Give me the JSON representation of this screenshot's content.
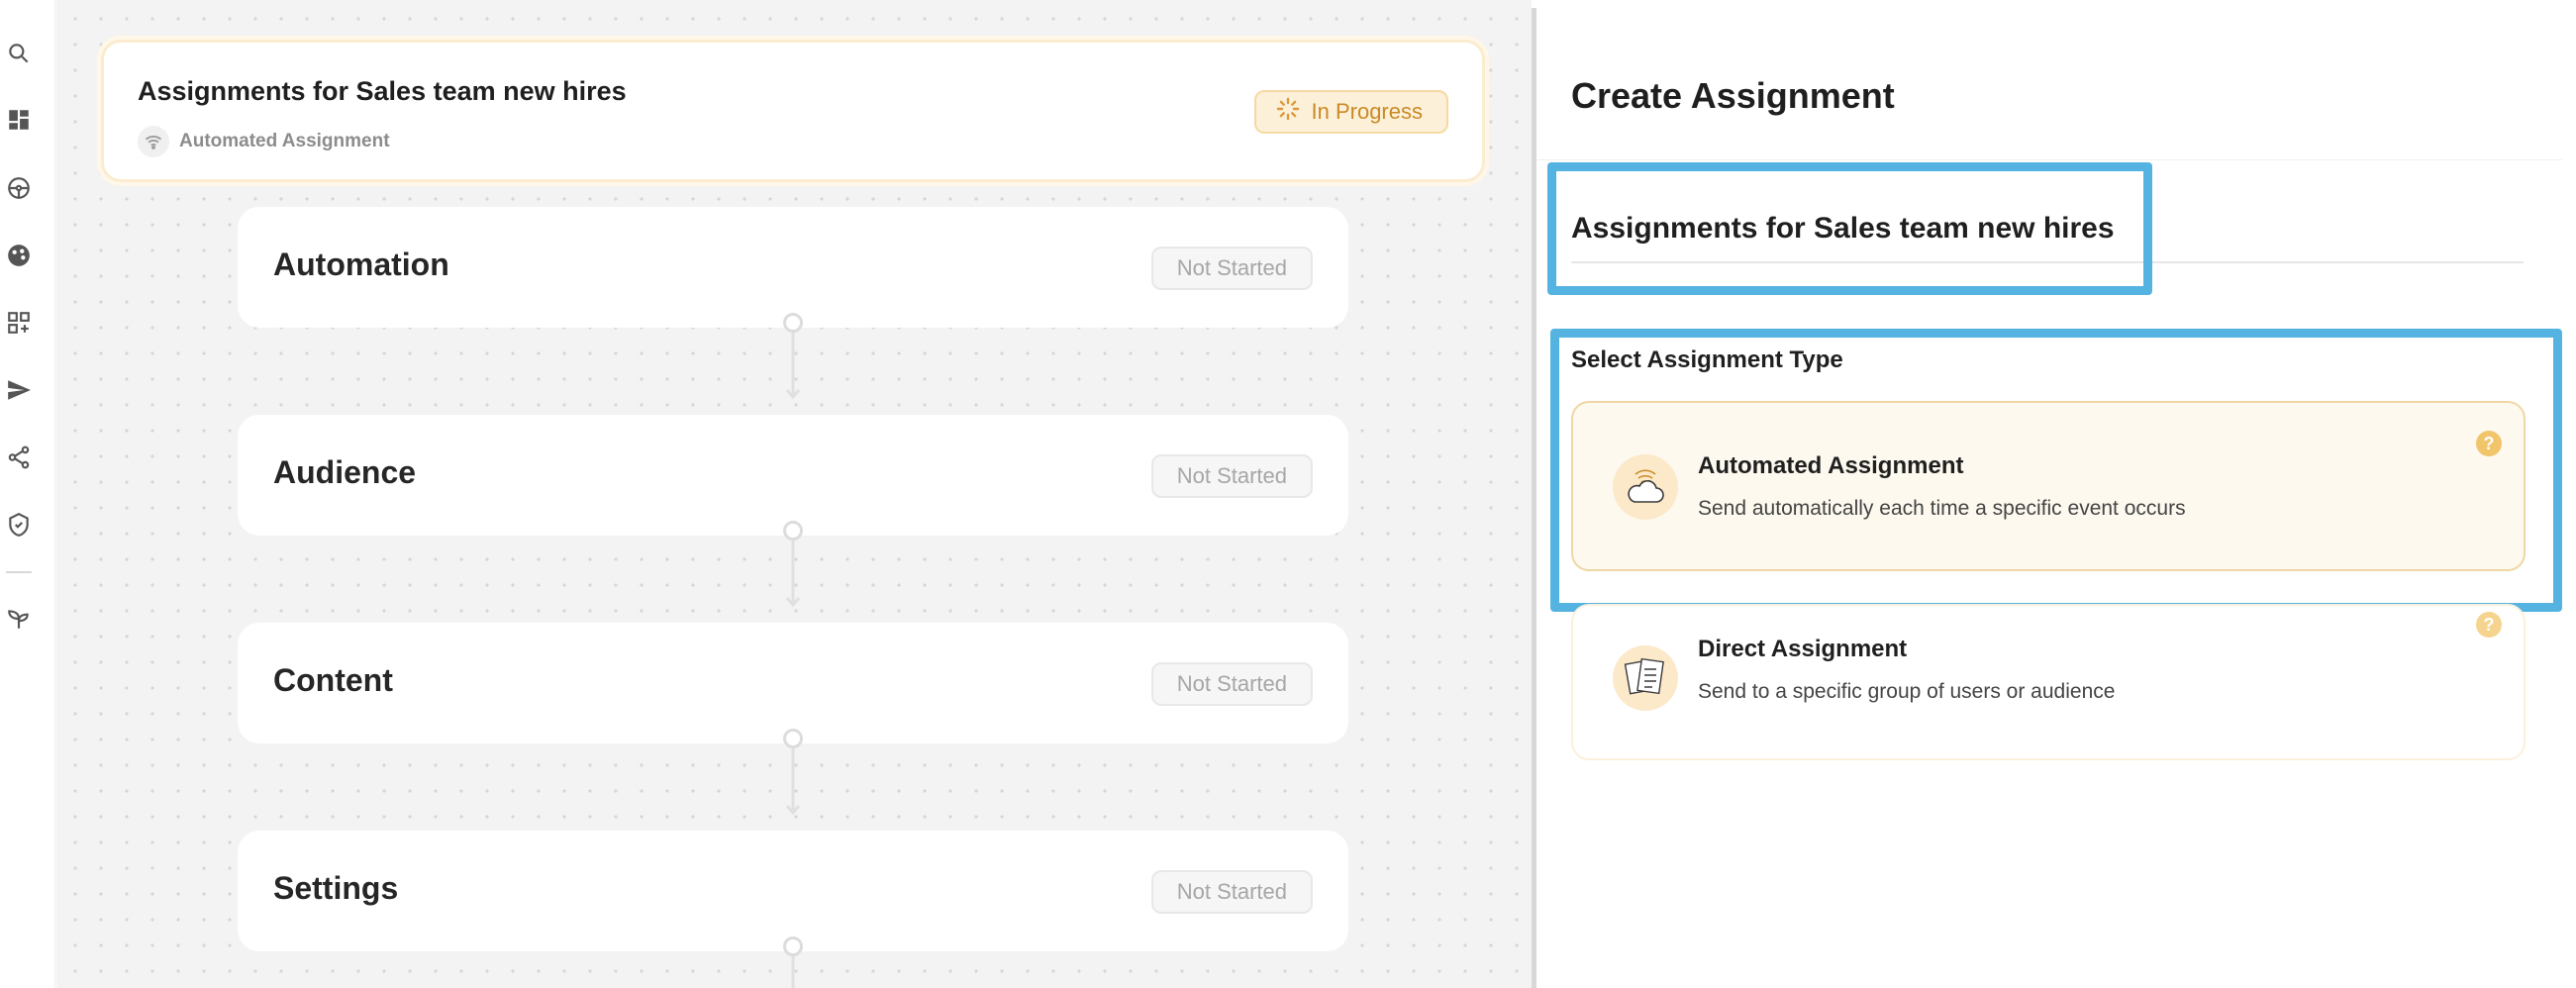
{
  "sidebar": {
    "icons": [
      "search-icon",
      "dashboard-icon",
      "steering-wheel-icon",
      "palette-icon",
      "add-widget-icon",
      "send-icon",
      "share-icon",
      "shield-icon",
      "sprout-icon"
    ]
  },
  "canvas": {
    "header_card": {
      "title": "Assignments for Sales team new hires",
      "subtitle": "Automated Assignment",
      "status": "In Progress"
    },
    "steps": [
      {
        "title": "Automation",
        "status": "Not Started"
      },
      {
        "title": "Audience",
        "status": "Not Started"
      },
      {
        "title": "Content",
        "status": "Not Started"
      },
      {
        "title": "Settings",
        "status": "Not Started"
      }
    ]
  },
  "panel": {
    "title": "Create Assignment",
    "assignment_name": "Assignments for Sales team new hires",
    "type_label": "Select Assignment Type",
    "options": [
      {
        "name": "Automated Assignment",
        "description": "Send automatically each time a specific event occurs",
        "icon": "cloud-wifi-icon",
        "selected": true
      },
      {
        "name": "Direct Assignment",
        "description": "Send to a specific group of users or audience",
        "icon": "documents-icon",
        "selected": false
      }
    ],
    "help_glyph": "?"
  },
  "colors": {
    "accent": "#c98a26",
    "highlight_box": "#55b3e1",
    "selected_bg": "#fdf9ef"
  }
}
